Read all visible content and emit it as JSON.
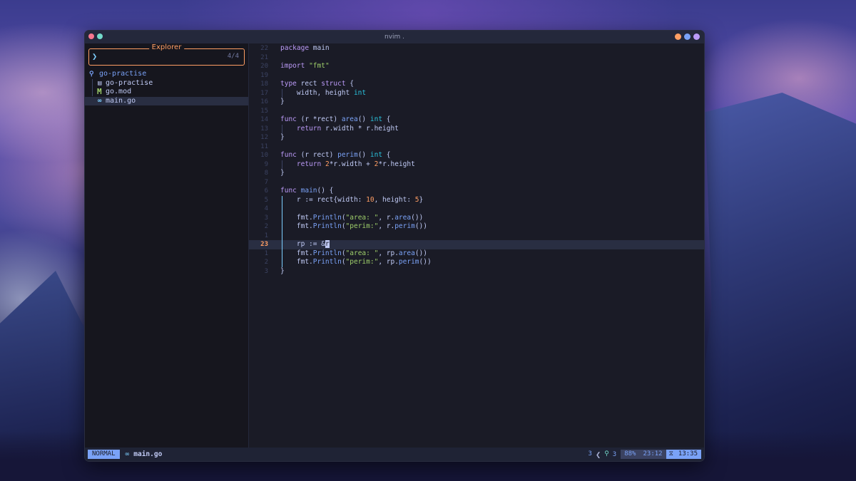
{
  "window": {
    "title": "nvim ."
  },
  "explorer": {
    "title": "Explorer",
    "prompt": "❯",
    "count": "4/4",
    "tree": [
      {
        "icon": "⚲",
        "label": "go-practise",
        "color": "#7aa2f7"
      },
      {
        "icon": "▤",
        "label": "go-practise",
        "color": "#c0caf5"
      },
      {
        "icon": "M",
        "label": "go.mod",
        "color": "#c0caf5"
      },
      {
        "icon": "∞",
        "label": "main.go",
        "color": "#c0caf5"
      }
    ]
  },
  "editor": {
    "line_numbers": [
      "22",
      "21",
      "20",
      "19",
      "18",
      "17",
      "16",
      "15",
      "14",
      "13",
      "12",
      "11",
      "10",
      "9",
      "8",
      "7",
      "6",
      "5",
      "4",
      "3",
      "2",
      "1",
      "23",
      "1",
      "2",
      "3"
    ],
    "current_line_index": 22
  },
  "statusline": {
    "mode": "NORMAL",
    "file_icon": "∞",
    "filename": "main.go",
    "diag_left": "3",
    "diag_right": "3",
    "percent": "88%",
    "position": "23:12",
    "clock": "13:35"
  },
  "colors": {
    "accent": "#7aa2f7",
    "explorer_border": "#ff9e64",
    "background": "#1a1b26"
  }
}
